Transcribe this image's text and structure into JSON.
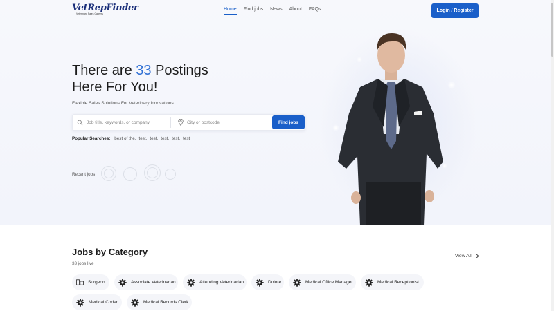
{
  "brand": {
    "logo_text": "VetRepFinder",
    "logo_sub": "Veterinary Sales Careers"
  },
  "nav": {
    "items": [
      "Home",
      "Find jobs",
      "News",
      "About",
      "FAQs"
    ],
    "active": "Home"
  },
  "header": {
    "login_label": "Login / Register"
  },
  "hero": {
    "headline_pre": "There are",
    "count": "33",
    "headline_post": "Postings",
    "headline_line2": "Here For You!",
    "tagline": "Flexible Sales Solutions For Veterinary Innovations"
  },
  "search": {
    "keyword_placeholder": "Job title, keywords, or company",
    "location_placeholder": "City or postcode",
    "button_label": "Find jobs"
  },
  "popular": {
    "label": "Popular Searches:",
    "terms": [
      "best of the,",
      "test,",
      "test,",
      "test,",
      "test,",
      "test"
    ]
  },
  "recent": {
    "label": "Recent jobs"
  },
  "categories": {
    "title": "Jobs by Category",
    "subtitle": "33 jobs live",
    "view_all": "View All",
    "items": [
      {
        "label": "Surgeon",
        "icon": "surgeon-icon"
      },
      {
        "label": "Associate Veterinarian",
        "icon": "gear-icon"
      },
      {
        "label": "Attending Veterinarian",
        "icon": "gear-icon"
      },
      {
        "label": "Dolore",
        "icon": "gear-icon"
      },
      {
        "label": "Medical Office Manager",
        "icon": "gear-icon"
      },
      {
        "label": "Medical Receptionist",
        "icon": "gear-icon"
      },
      {
        "label": "Medical Coder",
        "icon": "gear-icon"
      },
      {
        "label": "Medical Records Clerk",
        "icon": "gear-icon"
      }
    ]
  },
  "colors": {
    "accent": "#1a5fc9",
    "count_highlight": "#2f6fd4",
    "hero_bg": "#f4f5fb",
    "chip_bg": "#f4f5f9"
  }
}
